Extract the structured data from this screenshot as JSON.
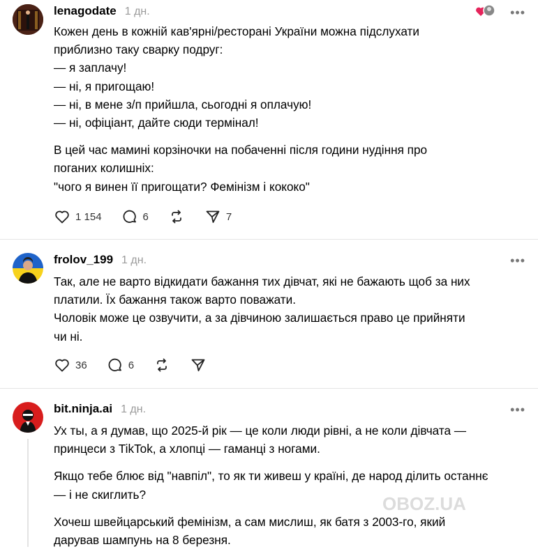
{
  "posts": [
    {
      "username": "lenagodate",
      "time": "1 дн.",
      "lines": [
        "Кожен день в кожній кав'ярні/ресторані України можна підслухати",
        "приблизно таку сварку подруг:",
        "— я заплачу!",
        "— ні, я пригощаю!",
        "— ні, в мене з/п прийшла, сьогодні я оплачую!",
        "— ні, офіціант, дайте сюди термінал!",
        "",
        "В цей час мамині корзіночки на побаченні після години нудіння про",
        "поганих колишніх:",
        "\"чого я винен її пригощати? Фемінізм і кококо\""
      ],
      "likes": "1 154",
      "replies": "6",
      "reposts": "",
      "shares": "7"
    },
    {
      "username": "frolov_199",
      "time": "1 дн.",
      "lines": [
        "Так, але не варто відкидати бажання тих дівчат, які не бажають щоб за них",
        "платили. Їх бажання також варто поважати.",
        "Чоловік може це озвучити, а за дівчиною залишається право це прийняти",
        "чи ні."
      ],
      "likes": "36",
      "replies": "6",
      "reposts": "",
      "shares": ""
    },
    {
      "username": "bit.ninja.ai",
      "time": "1 дн.",
      "lines": [
        "Ух ты, а я думав, що 2025-й рік — це коли люди рівні, а не коли дівчата —",
        "принцеси з TikTok, а хлопці — гаманці з ногами.",
        "",
        "Якщо тебе блює від \"навпіл\", то як ти живеш у країні, де народ ділить останнє",
        "— і не скиглить?",
        "",
        "Хочеш швейцарський фемінізм, а сам мислиш, як батя з 2003-го, який",
        "дарував шампунь на 8 березня."
      ]
    }
  ],
  "more_glyph": "•••",
  "watermark": "OBOZ.UA"
}
